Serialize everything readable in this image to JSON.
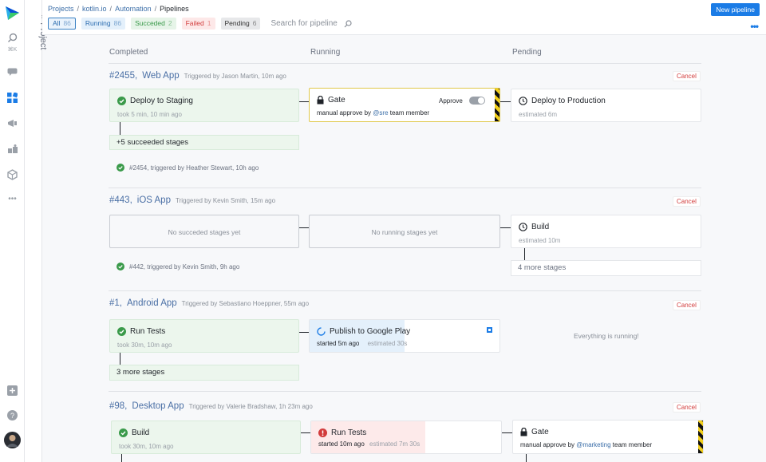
{
  "topbar": {
    "breadcrumbs": [
      "Projects",
      "kotlin.io",
      "Automation",
      "Pipelines"
    ],
    "filters": [
      {
        "label": "All",
        "count": "86"
      },
      {
        "label": "Running",
        "count": "86"
      },
      {
        "label": "Succeded",
        "count": "2"
      },
      {
        "label": "Failed",
        "count": "1"
      },
      {
        "label": "Pending",
        "count": "6"
      }
    ],
    "search_placeholder": "Search for pipeline",
    "new_button": "New pipeline",
    "more": "•••"
  },
  "sidebar": {
    "shortcut": "⌘K",
    "project_label": "Project",
    "more": "•••"
  },
  "columns": {
    "completed": "Completed",
    "running": "Running",
    "pending": "Pending"
  },
  "pipelines": [
    {
      "id": "#2455,",
      "name": "Web App",
      "triggered": "Triggered by Jason Martin, 10m ago",
      "cancel": "Cancel",
      "completed": {
        "title": "Deploy to Staging",
        "sub": "took 5 min, 10 min ago",
        "more": "+5 succeeded stages"
      },
      "running": {
        "title": "Gate",
        "approve": "Approve",
        "sub_pre": "manual approve by",
        "mention": "@sre",
        "sub_post": "team member"
      },
      "pending": {
        "title": "Deploy to Production",
        "sub": "estimated 6m"
      },
      "previous": "#2454,  triggered by Heather Stewart, 10h ago"
    },
    {
      "id": "#443,",
      "name": "iOS App",
      "triggered": "Triggered by Kevin Smith, 15m ago",
      "cancel": "Cancel",
      "completed_empty": "No succeded stages yet",
      "running_empty": "No running stages yet",
      "pending": {
        "title": "Build",
        "sub": "estimated 10m",
        "more": "4 more stages"
      },
      "previous": "#442,  triggered by Kevin Smith, 9h ago"
    },
    {
      "id": "#1,",
      "name": "Android App",
      "triggered": "Triggered by Sebastiano Hoeppner, 55m ago",
      "cancel": "Cancel",
      "completed": {
        "title": "Run Tests",
        "sub": "took 30m, 10m ago",
        "more": "3 more stages"
      },
      "running": {
        "title": "Publish to Google Play",
        "started": "started 5m ago",
        "estimated": "estimated 30s",
        "progress": 0.5
      },
      "pending_text": "Everything is running!"
    },
    {
      "id": "#98,",
      "name": "Desktop App",
      "triggered": "Triggered by Valerie Bradshaw, 1h 23m ago",
      "cancel": "Cancel",
      "completed": {
        "title": "Build",
        "sub": "took 30m, 10m ago"
      },
      "running": {
        "title": "Run Tests",
        "started": "started 10m ago",
        "estimated": "estimated 7m 30s",
        "progress": 0.6
      },
      "pending": {
        "title": "Gate",
        "sub_pre": "manual approve by",
        "mention": "@marketing",
        "sub_post": "team member"
      }
    }
  ],
  "colors": {
    "accent": "#1b7ce6",
    "success": "#3a9a4a",
    "failed": "#d23c3c",
    "link": "#4a6fa5"
  }
}
